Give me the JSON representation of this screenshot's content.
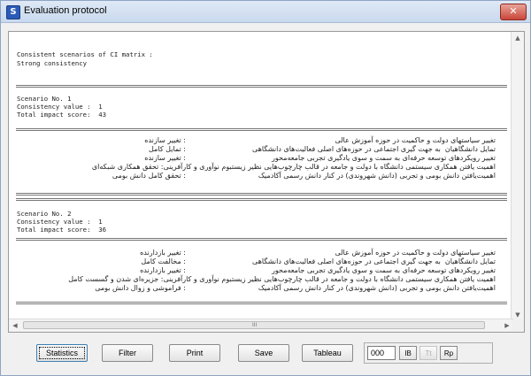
{
  "window": {
    "title": "Evaluation protocol",
    "close_glyph": "✕",
    "app_icon": "S"
  },
  "report": {
    "header": {
      "line1": "Consistent scenarios of CI matrix :",
      "line2": "Strong consistency"
    },
    "scenarios": [
      {
        "number": "Scenario No. 1",
        "consistency": "Consistency value :  1",
        "impact": "Total impact score:  43",
        "rows": [
          {
            "text": "تغییر سیاستهای دولت و حاکمیت در حوزه آموزش عالی",
            "label": ": تغییر سازنده"
          },
          {
            "text": "تمایل دانشگاهیان  به جهت گیری اجتماعی در حوزه‌های اصلی فعالیت‌های دانشگاهی",
            "label": ": تمایل کامل"
          },
          {
            "text": "تغییر رویکردهای توسعه حرفه‌ای به سمت و سوی یادگیری تجربی جامعه‌محور",
            "label": ": تغییر سازنده"
          },
          {
            "text": "اهمیت یافتن همکاری سیستمی دانشگاه با دولت و جامعه در قالب چارچوب‌هایی نظیر زیستبوم نوآوری و کارآفرینی: تحقق همکاری شبکه‌ای",
            "label": ""
          },
          {
            "text": "اهمیت‌یافتن دانش بومی و تجربی (دانش شهروندی) در کنار دانش رسمی آکادمیک",
            "label": ": تحقق کامل دانش بومی"
          }
        ]
      },
      {
        "number": "Scenario No. 2",
        "consistency": "Consistency value :  1",
        "impact": "Total impact score:  36",
        "rows": [
          {
            "text": "تغییر سیاستهای دولت و حاکمیت در حوزه آموزش عالی",
            "label": ": تغییر بازدارنده"
          },
          {
            "text": "تمایل دانشگاهیان  به جهت گیری اجتماعی در حوزه‌های اصلی فعالیت‌های دانشگاهی",
            "label": ": مخالفت کامل"
          },
          {
            "text": "تغییر رویکردهای توسعه حرفه‌ای به سمت و سوی یادگیری تجربی جامعه‌محور",
            "label": ": تغییر بازدارنده"
          },
          {
            "text": "اهمیت یافتن همکاری سیستمی دانشگاه با دولت و جامعه در قالب چارچوب‌هایی نظیر زیستبوم نوآوری و کارآفرینی: جزیره‌ای شدن و گسست کامل",
            "label": ""
          },
          {
            "text": "اهمیت‌یافتن دانش بومی و تجربی (دانش شهروندی) در کنار دانش رسمی آکادمیک",
            "label": ": فراموشی و زوال دانش بومی"
          }
        ]
      }
    ]
  },
  "scroll": {
    "up": "▲",
    "down": "▼",
    "left": "◀",
    "right": "▶",
    "grip": "III"
  },
  "buttons": {
    "statistics": "Statistics",
    "filter": "Filter",
    "print": "Print",
    "save": "Save",
    "tableau": "Tableau"
  },
  "font_controls": {
    "size": "000",
    "bold": "IB",
    "italic": "Tt",
    "reset": "Rp"
  }
}
